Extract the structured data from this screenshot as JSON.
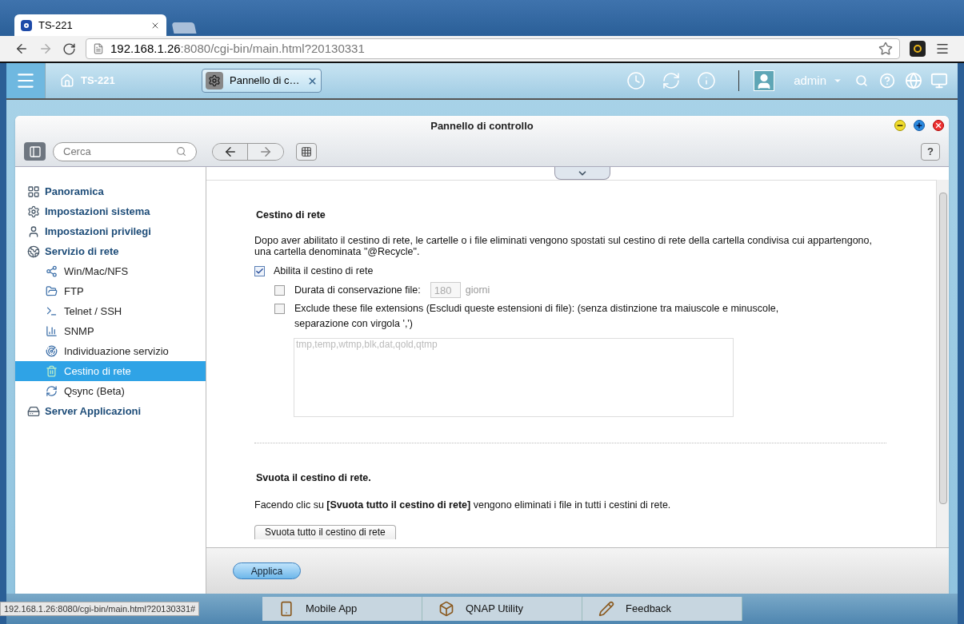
{
  "browser": {
    "tab": {
      "title": "TS-221"
    },
    "address": {
      "host": "192.168.1.26",
      "path": ":8080/cgi-bin/main.html?20130331"
    }
  },
  "topbar": {
    "home": "TS-221",
    "app_tab": {
      "title": "Pannello di c…",
      "selected": true
    },
    "user": "admin"
  },
  "window": {
    "title": "Pannello di controllo",
    "search": {
      "placeholder": "Cerca"
    },
    "help": "?"
  },
  "sidebar": {
    "items": [
      {
        "label": "Panoramica",
        "selected": false
      },
      {
        "label": "Impostazioni sistema",
        "selected": false
      },
      {
        "label": "Impostazioni privilegi",
        "selected": false
      },
      {
        "label": "Servizio di rete",
        "selected": false,
        "children": [
          {
            "label": "Win/Mac/NFS",
            "selected": false
          },
          {
            "label": "FTP",
            "selected": false
          },
          {
            "label": "Telnet / SSH",
            "selected": false
          },
          {
            "label": "SNMP",
            "selected": false
          },
          {
            "label": "Individuazione servizio",
            "selected": false
          },
          {
            "label": "Cestino di rete",
            "selected": true
          },
          {
            "label": "Qsync (Beta)",
            "selected": false
          }
        ]
      },
      {
        "label": "Server Applicazioni",
        "selected": false
      }
    ]
  },
  "content": {
    "section1": {
      "title": "Cestino di rete",
      "description": "Dopo aver abilitato il cestino di rete, le cartelle o i file eliminati vengono spostati sul cestino di rete della cartella condivisa cui appartengono, una cartella denominata \"@Recycle\".",
      "enable": {
        "label": "Abilita il cestino di rete",
        "checked": true
      },
      "retention": {
        "label": "Durata di conservazione file:",
        "checked": false,
        "value": "180",
        "unit": "giorni",
        "disabled": true
      },
      "exclude": {
        "label": "Exclude these file extensions (Escludi queste estensioni di file): (senza distinzione tra maiuscole e minuscole, separazione con virgola ',')",
        "checked": false,
        "value": "tmp,temp,wtmp,blk,dat,qold,qtmp",
        "disabled": true
      }
    },
    "section2": {
      "title": "Svuota il cestino di rete.",
      "description": "Facendo clic su **[Svuota tutto il cestino di rete]** vengono eliminati i file in tutti i cestini di rete.",
      "button": "Svuota tutto il cestino di rete"
    }
  },
  "footer": {
    "apply": "Applica"
  },
  "dock": [
    "Mobile App",
    "QNAP Utility",
    "Feedback"
  ],
  "status_url": "192.168.1.26:8080/cgi-bin/main.html?20130331#"
}
